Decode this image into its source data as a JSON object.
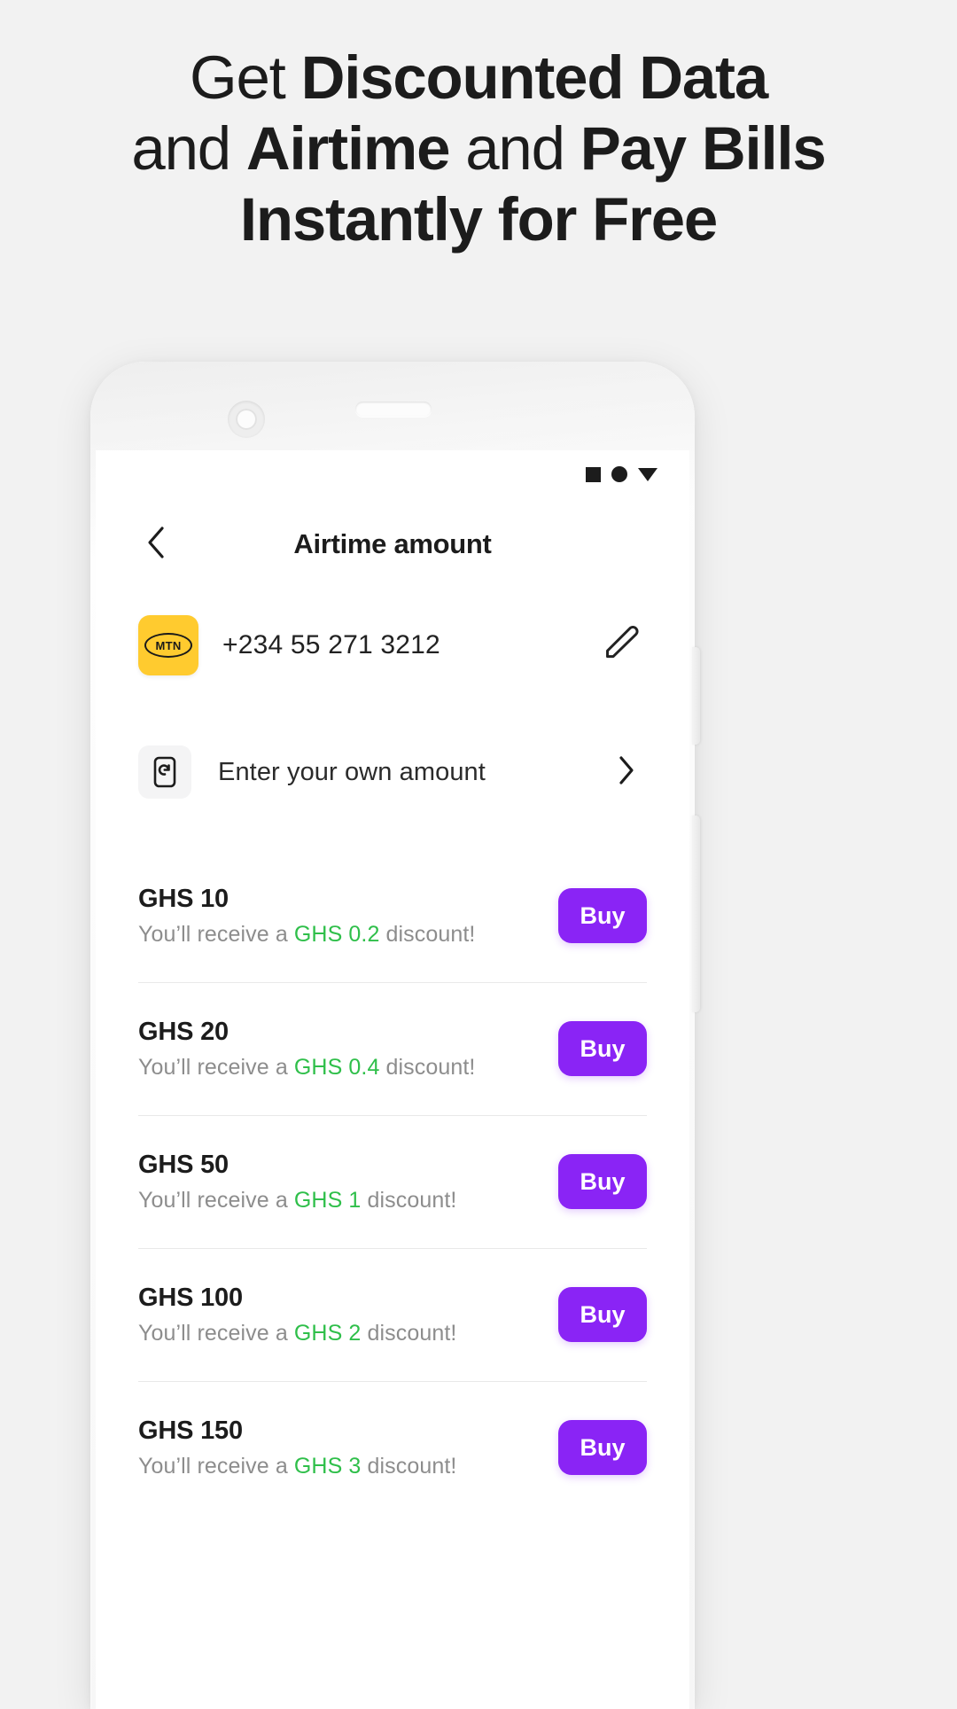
{
  "headline": {
    "line1_plain": "Get ",
    "line1_bold": "Discounted Data",
    "line2_plain_a": "and ",
    "line2_bold_a": "Airtime",
    "line2_plain_b": " and ",
    "line2_bold_b": "Pay Bills",
    "line3_bold": "Instantly for Free"
  },
  "colors": {
    "page_background": "#f2f2f2",
    "text_primary": "#1c1c1c",
    "accent_purple": "#8a24f5",
    "discount_green": "#2fbf4a",
    "mtn_yellow": "#ffcb2f",
    "subtext_gray": "#8d8d8d",
    "divider": "#e9e9e9"
  },
  "phone": {
    "camera_icon": "camera-dot-icon",
    "speaker_icon": "earpiece-speaker-icon",
    "side_button_top": "volume-button",
    "side_button_bottom": "power-button"
  },
  "statusbar": {
    "icons": [
      "square-icon",
      "circle-icon",
      "triangle-down-icon"
    ]
  },
  "header": {
    "back_icon": "chevron-left-icon",
    "title": "Airtime amount"
  },
  "msisdn": {
    "network_logo_text": "MTN",
    "network_logo_icon": "mtn-logo-icon",
    "phone_number": "+234 55 271 3212",
    "edit_icon": "pencil-edit-icon"
  },
  "own_amount": {
    "icon": "phone-recharge-icon",
    "label": "Enter your own amount",
    "chevron_icon": "chevron-right-icon"
  },
  "denominations": [
    {
      "amount": "GHS 10",
      "sub_prefix": "You’ll receive a ",
      "discount": "GHS 0.2",
      "sub_suffix": " discount!",
      "buy_label": "Buy"
    },
    {
      "amount": "GHS 20",
      "sub_prefix": "You’ll receive a ",
      "discount": "GHS 0.4",
      "sub_suffix": " discount!",
      "buy_label": "Buy"
    },
    {
      "amount": "GHS 50",
      "sub_prefix": "You’ll receive a ",
      "discount": "GHS 1",
      "sub_suffix": " discount!",
      "buy_label": "Buy"
    },
    {
      "amount": "GHS 100",
      "sub_prefix": "You’ll receive a ",
      "discount": "GHS 2",
      "sub_suffix": " discount!",
      "buy_label": "Buy"
    },
    {
      "amount": "GHS 150",
      "sub_prefix": "You’ll receive a ",
      "discount": "GHS 3",
      "sub_suffix": " discount!",
      "buy_label": "Buy"
    }
  ]
}
